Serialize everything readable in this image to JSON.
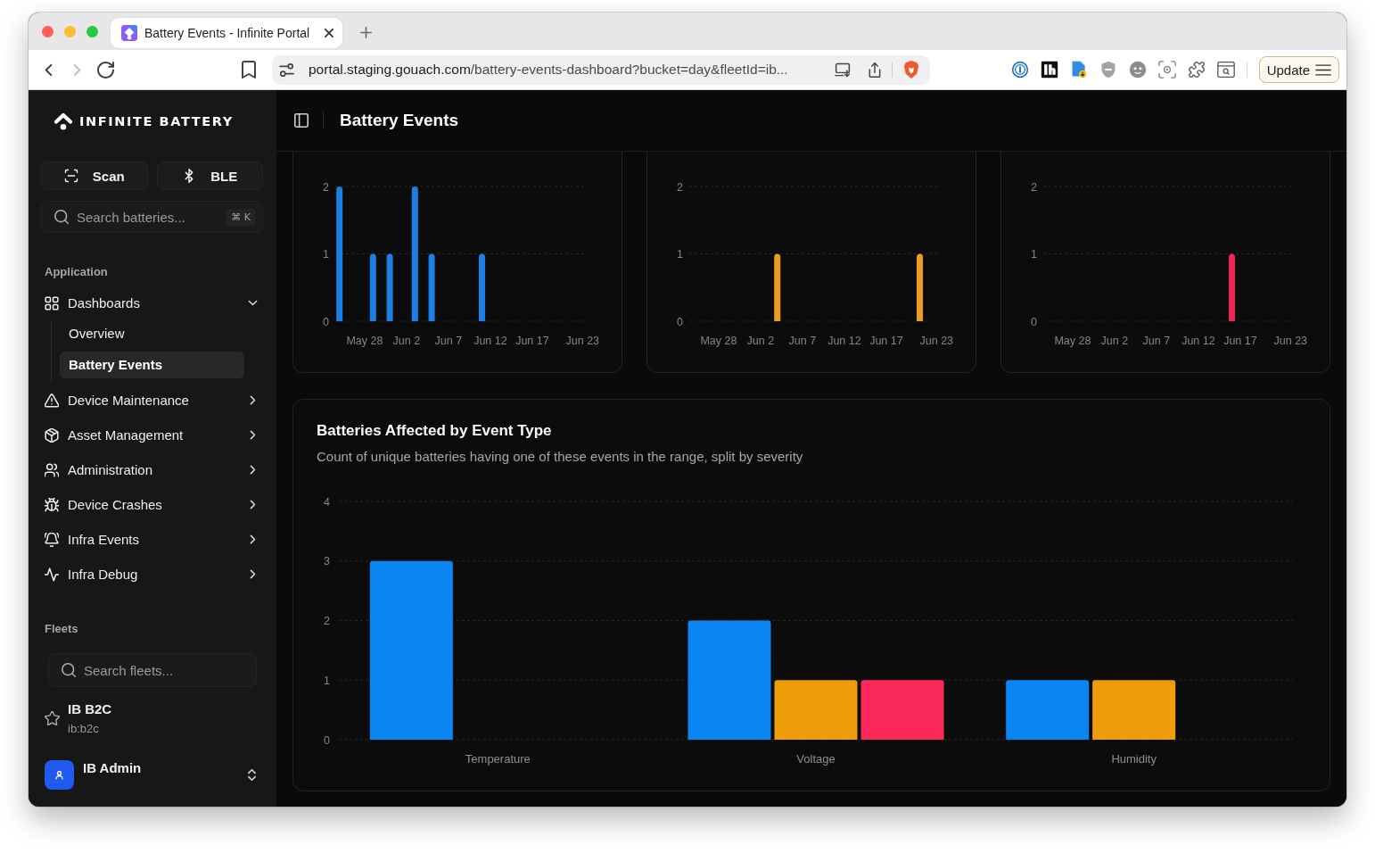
{
  "browser": {
    "tabs": [
      {
        "title": "Battery Events - Infinite Portal",
        "selected": true
      }
    ],
    "nav_buttons": [
      {
        "kind": "back",
        "disabled": false
      },
      {
        "kind": "forward",
        "disabled": true
      },
      {
        "kind": "reload",
        "disabled": false
      }
    ],
    "address_bar": {
      "host": "portal.staging.gouach.com",
      "path": "/battery-events-dashboard?bucket=day&fleetId=ib..."
    },
    "menu_button": {
      "label": "Update"
    }
  },
  "sidebar": {
    "brand": "INFINITE BATTERY",
    "actions": [
      {
        "label": "Scan"
      },
      {
        "label": "BLE"
      }
    ],
    "search": {
      "placeholder": "Search batteries...",
      "shortcut": "⌘ K"
    },
    "application": {
      "label": "Application",
      "items": [
        {
          "label": "Dashboards",
          "expanded": true,
          "children": [
            {
              "label": "Overview",
              "selected": false
            },
            {
              "label": "Battery Events",
              "selected": true
            }
          ]
        },
        {
          "label": "Device Maintenance",
          "expanded": false
        },
        {
          "label": "Asset Management",
          "expanded": false
        },
        {
          "label": "Administration",
          "expanded": false
        },
        {
          "label": "Device Crashes",
          "expanded": false
        },
        {
          "label": "Infra Events",
          "expanded": false
        },
        {
          "label": "Infra Debug",
          "expanded": false
        }
      ]
    },
    "fleets": {
      "label": "Fleets",
      "search": {
        "placeholder": "Search fleets..."
      },
      "items": [
        {
          "name": "IB B2C",
          "id": "ib:b2c",
          "favorite": false
        }
      ]
    },
    "user": {
      "name": "IB Admin"
    }
  },
  "main": {
    "header": {
      "title": "Battery Events"
    },
    "event_charts": [
      {
        "chart_data": {
          "type": "bar",
          "categories": [
            null,
            null,
            null,
            "May 28",
            null,
            null,
            null,
            null,
            "Jun 2",
            null,
            null,
            null,
            null,
            "Jun 7",
            null,
            null,
            null,
            null,
            "Jun 12",
            null,
            null,
            null,
            null,
            "Jun 17",
            null,
            null,
            null,
            null,
            null,
            "Jun 23"
          ],
          "series": [
            {
              "color": "#1a80e6",
              "values": [
                2,
                0,
                0,
                0,
                1,
                0,
                1,
                0,
                0,
                2,
                0,
                1,
                0,
                0,
                0,
                0,
                0,
                1,
                0,
                0,
                0,
                0,
                0,
                0,
                0,
                0,
                0,
                0,
                0,
                0
              ]
            }
          ],
          "ylim": [
            0,
            2
          ],
          "yticks": [
            0,
            1,
            2
          ],
          "grid": true
        }
      },
      {
        "chart_data": {
          "type": "bar",
          "categories": [
            null,
            null,
            null,
            "May 28",
            null,
            null,
            null,
            null,
            "Jun 2",
            null,
            null,
            null,
            null,
            "Jun 7",
            null,
            null,
            null,
            null,
            "Jun 12",
            null,
            null,
            null,
            null,
            "Jun 17",
            null,
            null,
            null,
            null,
            null,
            "Jun 23"
          ],
          "series": [
            {
              "color": "#eb9d22",
              "values": [
                0,
                0,
                0,
                0,
                0,
                0,
                0,
                0,
                0,
                0,
                1,
                0,
                0,
                0,
                0,
                0,
                0,
                0,
                0,
                0,
                0,
                0,
                0,
                0,
                0,
                0,
                0,
                1,
                0,
                0
              ]
            }
          ],
          "ylim": [
            0,
            2
          ],
          "yticks": [
            0,
            1,
            2
          ],
          "grid": true
        }
      },
      {
        "chart_data": {
          "type": "bar",
          "categories": [
            null,
            null,
            null,
            "May 28",
            null,
            null,
            null,
            null,
            "Jun 2",
            null,
            null,
            null,
            null,
            "Jun 7",
            null,
            null,
            null,
            null,
            "Jun 12",
            null,
            null,
            null,
            null,
            "Jun 17",
            null,
            null,
            null,
            null,
            null,
            "Jun 23"
          ],
          "series": [
            {
              "color": "#ee2653",
              "values": [
                0,
                0,
                0,
                0,
                0,
                0,
                0,
                0,
                0,
                0,
                0,
                0,
                0,
                0,
                0,
                0,
                0,
                0,
                0,
                0,
                0,
                0,
                1,
                0,
                0,
                0,
                0,
                0,
                0,
                0
              ]
            }
          ],
          "ylim": [
            0,
            2
          ],
          "yticks": [
            0,
            1,
            2
          ],
          "grid": true
        }
      }
    ],
    "event_type_card": {
      "title": "Batteries Affected by Event Type",
      "description": "Count of unique batteries having one of these events in the range, split by severity",
      "chart_data": {
        "type": "bar",
        "categories": [
          "Temperature",
          "Voltage",
          "Humidity"
        ],
        "series": [
          {
            "color": "#0a85f2",
            "values": [
              3,
              2,
              1
            ]
          },
          {
            "color": "#ef9c0b",
            "values": [
              0,
              1,
              1
            ]
          },
          {
            "color": "#fc2a5b",
            "values": [
              0,
              1,
              0
            ]
          }
        ],
        "ylim": [
          0,
          4
        ],
        "yticks": [
          0,
          1,
          2,
          3,
          4
        ],
        "grid": true
      }
    }
  }
}
